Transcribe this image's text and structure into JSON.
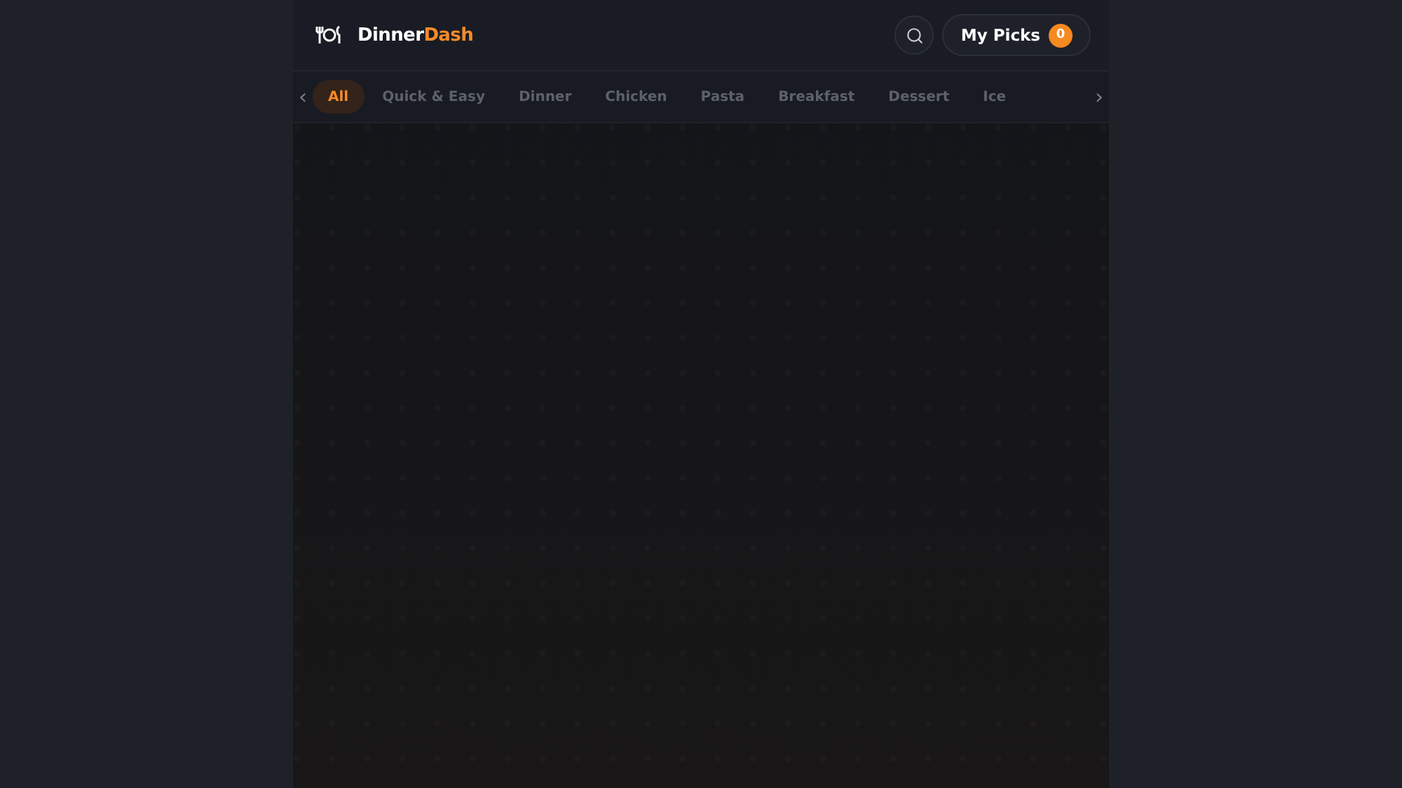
{
  "header": {
    "brand": {
      "name_start": "Dinner",
      "name_end": "Dash"
    },
    "picks_button": {
      "label": "My Picks",
      "count": "0"
    }
  },
  "categories": {
    "prev": "‹",
    "next": "›",
    "items": [
      {
        "label": "All",
        "selected": true
      },
      {
        "label": "Quick & Easy",
        "selected": false
      },
      {
        "label": "Dinner",
        "selected": false
      },
      {
        "label": "Chicken",
        "selected": false
      },
      {
        "label": "Pasta",
        "selected": false
      },
      {
        "label": "Breakfast",
        "selected": false
      },
      {
        "label": "Dessert",
        "selected": false
      },
      {
        "label": "Ice",
        "selected": false
      }
    ]
  }
}
